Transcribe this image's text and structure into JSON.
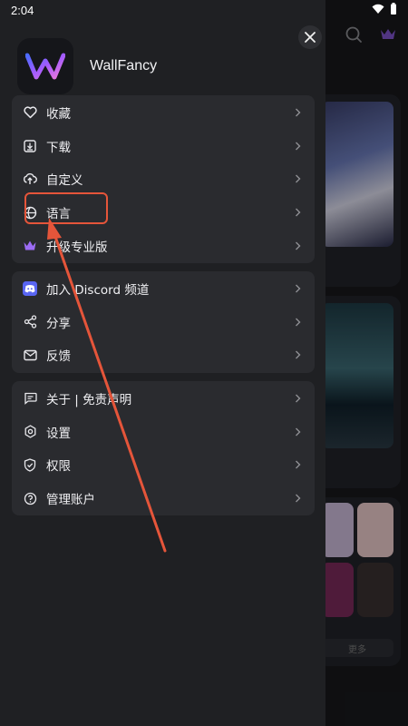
{
  "status_bar": {
    "time": "2:04"
  },
  "drawer": {
    "app_name": "WallFancy",
    "groups": [
      {
        "items": [
          {
            "label": "收藏",
            "icon": "heart-icon"
          },
          {
            "label": "下载",
            "icon": "download-icon"
          },
          {
            "label": "自定义",
            "icon": "upload-cloud-icon"
          },
          {
            "label": "语言",
            "icon": "globe-icon"
          },
          {
            "label": "升级专业版",
            "icon": "crown-icon"
          }
        ]
      },
      {
        "items": [
          {
            "label": "加入 Discord 频道",
            "icon": "discord-icon"
          },
          {
            "label": "分享",
            "icon": "share-icon"
          },
          {
            "label": "反馈",
            "icon": "mail-icon"
          }
        ]
      },
      {
        "items": [
          {
            "label": "关于 | 免责声明",
            "icon": "chat-icon"
          },
          {
            "label": "设置",
            "icon": "settings-icon"
          },
          {
            "label": "权限",
            "icon": "shield-check-icon"
          },
          {
            "label": "管理账户",
            "icon": "help-icon"
          }
        ]
      }
    ]
  },
  "background": {
    "more_button_label": "更多"
  },
  "colors": {
    "accent_purple": "#a066ff",
    "annotation_red": "#e5553a",
    "drawer_bg": "#1f2023",
    "group_bg": "#2a2b2f"
  }
}
